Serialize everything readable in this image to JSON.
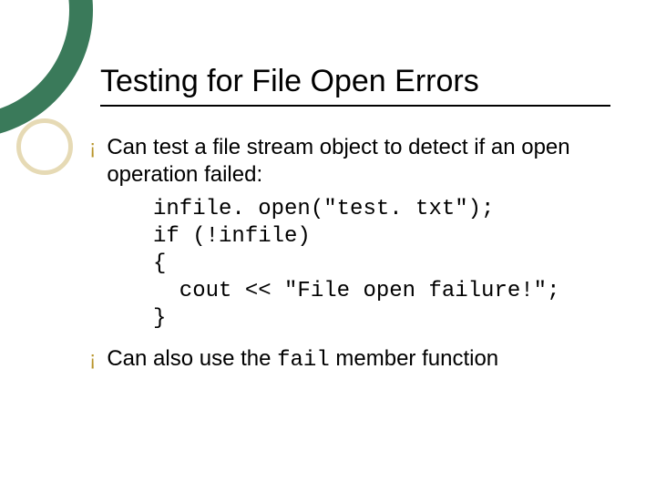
{
  "title": "Testing for File Open Errors",
  "bullets": {
    "b1": "Can test a file stream object to detect if an open operation failed:",
    "b2_pre": "Can also use the ",
    "b2_code": "fail",
    "b2_post": " member function"
  },
  "code": "infile. open(\"test. txt\");\nif (!infile)\n{\n  cout << \"File open failure!\";\n}",
  "bullet_char": "¡"
}
